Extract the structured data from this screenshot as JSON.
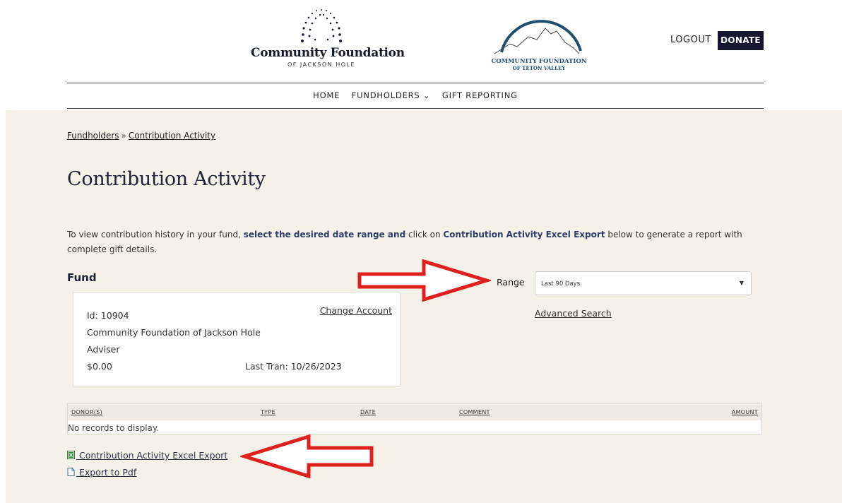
{
  "header": {
    "logo1_name": "Community Foundation",
    "logo1_sub": "OF JACKSON HOLE",
    "logo2_line1": "COMMUNITY FOUNDATION",
    "logo2_line2": "OF TETON VALLEY",
    "logout_label": "LOGOUT",
    "donate_label": "DONATE"
  },
  "nav": {
    "items": [
      {
        "label": "HOME"
      },
      {
        "label": "FUNDHOLDERS ⌄"
      },
      {
        "label": "GIFT REPORTING"
      }
    ]
  },
  "breadcrumb": {
    "parent": "Fundholders",
    "separator": "»",
    "current": "Contribution Activity"
  },
  "page_title": "Contribution Activity",
  "intro": {
    "part1": "To view contribution history in your fund, ",
    "bold": "select the desired date range and",
    "part2": " click on ",
    "bold2": "Contribution Activity Excel Export",
    "part3": " below to generate a report with complete gift details."
  },
  "fund": {
    "label": "Fund",
    "id_text": "Id: 10904",
    "change_label": "Change Account",
    "name": "Community Foundation of Jackson Hole",
    "role": "Adviser",
    "balance": "$0.00",
    "last_tran": "Last Tran: 10/26/2023"
  },
  "range": {
    "label": "Range",
    "selected": "Last 90 Days",
    "advanced_search": "Advanced Search"
  },
  "grid": {
    "columns": [
      "DONOR(S)",
      "TYPE",
      "DATE",
      "COMMENT",
      "AMOUNT"
    ],
    "empty_message": "No records to display."
  },
  "exports": {
    "excel_label": " Contribution Activity Excel Export",
    "pdf_label": " Export to Pdf"
  },
  "colors": {
    "navy": "#161633",
    "beige": "#f4f2e8",
    "arrow_red": "#e0201f",
    "teal_logo": "#1e4f6e"
  }
}
